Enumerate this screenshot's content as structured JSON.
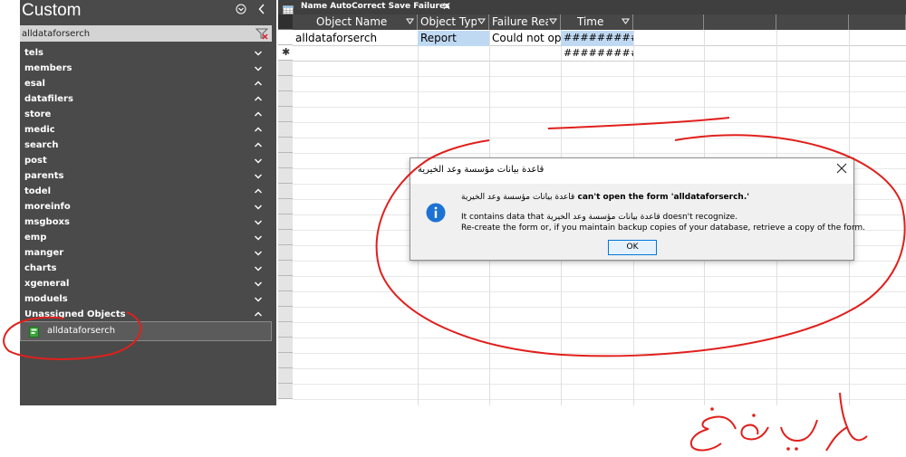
{
  "nav": {
    "title": "Custom",
    "search_value": "alldataforserch",
    "groups": [
      {
        "label": "tels",
        "state": "collapsed"
      },
      {
        "label": "members",
        "state": "collapsed"
      },
      {
        "label": "esal",
        "state": "expanded"
      },
      {
        "label": "datafilers",
        "state": "expanded"
      },
      {
        "label": "store",
        "state": "expanded"
      },
      {
        "label": "medic",
        "state": "expanded"
      },
      {
        "label": "search",
        "state": "expanded"
      },
      {
        "label": "post",
        "state": "collapsed"
      },
      {
        "label": "parents",
        "state": "collapsed"
      },
      {
        "label": "todel",
        "state": "expanded"
      },
      {
        "label": "moreinfo",
        "state": "collapsed"
      },
      {
        "label": "msgboxs",
        "state": "collapsed"
      },
      {
        "label": "emp",
        "state": "collapsed"
      },
      {
        "label": "manger",
        "state": "collapsed"
      },
      {
        "label": "charts",
        "state": "collapsed"
      },
      {
        "label": "xgeneral",
        "state": "collapsed"
      },
      {
        "label": "moduels",
        "state": "collapsed"
      },
      {
        "label": "Unassigned Objects",
        "state": "expanded"
      }
    ],
    "item": {
      "label": "alldataforserch",
      "icon": "form-icon"
    }
  },
  "sheet": {
    "tab_label": "Name AutoCorrect Save Failures",
    "tab_close": "✕",
    "columns": [
      "Object Name",
      "Object Type",
      "Failure Rea",
      "Time"
    ],
    "rows": [
      [
        "alldataforserch",
        "Report",
        "Could not ope",
        "###########"
      ],
      [
        "",
        "",
        "",
        "###########"
      ]
    ],
    "new_record_marker": "✱"
  },
  "dialog": {
    "title": "قاعدة بيانات مؤسسة وعد الخيرية",
    "line1_db": "قاعدة بيانات مؤسسة وعد الخيرية",
    "line1_text": "can't open the form 'alldataforserch.'",
    "line2_prefix": "It contains data that",
    "line2_db": "قاعدة بيانات مؤسسة وعد الخيرية",
    "line2_suffix": "doesn't recognize.",
    "line3": "Re-create the form or, if you maintain backup copies of your database, retrieve a copy of the form.",
    "ok_label": "OK",
    "icon": "info-icon"
  },
  "annotation": {
    "handwritten_text": "لا يفتح",
    "color": "#e0201c"
  },
  "colors": {
    "nav_bg": "#4a4a4a",
    "grid_header_bg": "#474747",
    "highlight": "#bfd9f2",
    "ok_border": "#0078d7"
  }
}
